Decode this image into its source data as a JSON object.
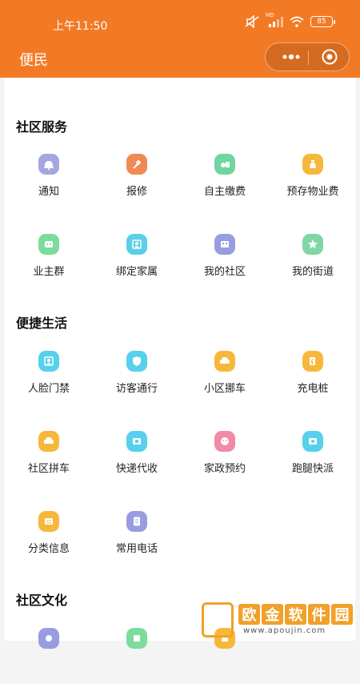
{
  "status": {
    "time": "上午11:50",
    "battery": "85",
    "hd": "HD"
  },
  "nav": {
    "title": "便民"
  },
  "sections": [
    {
      "title": "社区服务",
      "items": [
        {
          "label": "通知",
          "icon": "bell-icon",
          "color": "#a4a6df"
        },
        {
          "label": "报修",
          "icon": "wrench-icon",
          "color": "#f08a55"
        },
        {
          "label": "自主缴费",
          "icon": "payment-icon",
          "color": "#6fd6a0"
        },
        {
          "label": "预存物业费",
          "icon": "money-bag-icon",
          "color": "#f6b83b"
        },
        {
          "label": "业主群",
          "icon": "group-chat-icon",
          "color": "#7cdc9c"
        },
        {
          "label": "绑定家属",
          "icon": "family-icon",
          "color": "#5bcfe8"
        },
        {
          "label": "我的社区",
          "icon": "community-icon",
          "color": "#9a9ce0"
        },
        {
          "label": "我的街道",
          "icon": "star-icon",
          "color": "#7fd8a4"
        }
      ]
    },
    {
      "title": "便捷生活",
      "items": [
        {
          "label": "人脸门禁",
          "icon": "face-id-icon",
          "color": "#56d0ec"
        },
        {
          "label": "访客通行",
          "icon": "shield-icon",
          "color": "#56d0ec"
        },
        {
          "label": "小区挪车",
          "icon": "car-icon",
          "color": "#f6b83b"
        },
        {
          "label": "充电桩",
          "icon": "charging-icon",
          "color": "#f6b83b"
        },
        {
          "label": "社区拼车",
          "icon": "carpool-icon",
          "color": "#f6b83b"
        },
        {
          "label": "快递代收",
          "icon": "parcel-icon",
          "color": "#56d0ec"
        },
        {
          "label": "家政预约",
          "icon": "housekeeping-icon",
          "color": "#f08aa8"
        },
        {
          "label": "跑腿快派",
          "icon": "delivery-icon",
          "color": "#56d0ec"
        },
        {
          "label": "分类信息",
          "icon": "category-icon",
          "color": "#f6b83b"
        },
        {
          "label": "常用电话",
          "icon": "phone-book-icon",
          "color": "#9a9ce0"
        }
      ]
    },
    {
      "title": "社区文化",
      "items": [
        {
          "label": "",
          "icon": "culture-icon",
          "color": "#9a9ce0"
        },
        {
          "label": "",
          "icon": "activity-icon",
          "color": "#7cdc9c"
        },
        {
          "label": "",
          "icon": "notice-icon",
          "color": "#f6b83b"
        }
      ]
    }
  ],
  "watermark": {
    "chars": [
      "欧",
      "金",
      "软",
      "件",
      "园"
    ],
    "url": "www.apoujin.com"
  }
}
